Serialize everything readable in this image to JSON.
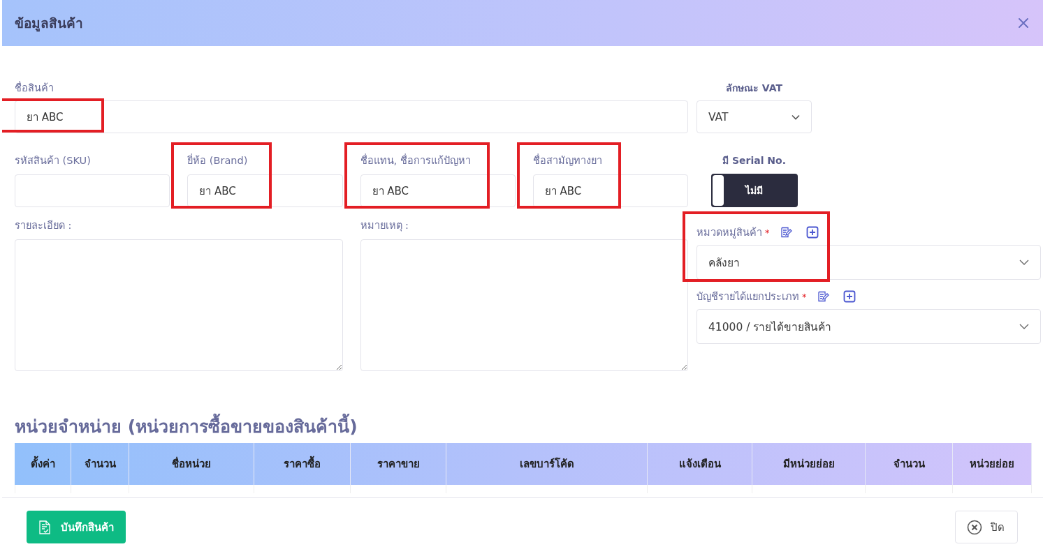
{
  "dialog": {
    "title": "ข้อมูลสินค้า"
  },
  "name_field": {
    "label": "ชื่อสินค้า",
    "value": "ยา ABC",
    "highlighted": true
  },
  "code_fields": [
    {
      "label": "รหัสสินค้า (SKU)",
      "highlighted": false
    },
    {
      "label": "ยี่ห้อ (Brand)",
      "value": "ยา ABC",
      "highlighted": true
    },
    {
      "label": "ชื่อแทน, ชื่อการแก้ปัญหา",
      "value": "ยา ABC",
      "highlighted": true
    },
    {
      "label": "ชื่อสามัญทางยา",
      "value": "ยา ABC",
      "highlighted": true
    }
  ],
  "text_areas": [
    {
      "label": "รายละเอียด :"
    },
    {
      "label": "หมายเหตุ :"
    }
  ],
  "vat": {
    "label": "ลักษณะ VAT",
    "value": "VAT"
  },
  "serial": {
    "label": "มี Serial No.",
    "toggle_text": "ไม่มี",
    "on": false
  },
  "selects": [
    {
      "label": "หมวดหมู่สินค้า",
      "required_mark": "*",
      "value": "คลังยา",
      "highlighted": true
    },
    {
      "label": "บัญชีรายได้แยกประเภท",
      "required_mark": "*",
      "value": "41000 / รายได้ขายสินค้า",
      "highlighted": false
    }
  ],
  "units": {
    "title": "หน่วยจำหน่าย (หน่วยการซื้อขายของสินค้านี้)",
    "columns": [
      "ตั้งค่า",
      "จำนวน",
      "ชื่อหน่วย",
      "ราคาซื้อ",
      "ราคาขาย",
      "เลขบาร์โค้ด",
      "แจ้งเตือน",
      "มีหน่วยย่อย",
      "จำนวน",
      "หน่วยย่อย"
    ]
  },
  "footer": {
    "save_label": "บันทึกสินค้า",
    "close_label": "ปิด"
  }
}
